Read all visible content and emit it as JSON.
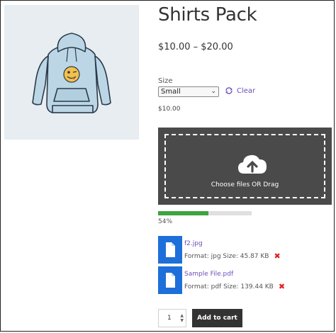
{
  "product": {
    "title": "Shirts Pack",
    "price_range": "$10.00 – $20.00",
    "image_icon": "hoodie-product-image"
  },
  "variation": {
    "label": "Size",
    "selected": "Small",
    "clear_label": "Clear",
    "price": "$10.00"
  },
  "upload": {
    "drop_text": "Choose files OR Drag",
    "progress_percent": 54,
    "progress_label": "54%",
    "progress_color": "#3fa33f",
    "files": [
      {
        "name": "f2.jpg",
        "meta": "Format: jpg Size: 45.87 KB"
      },
      {
        "name": "Sample File.pdf",
        "meta": "Format: pdf Size: 139.44 KB"
      }
    ]
  },
  "cart": {
    "quantity": "1",
    "add_label": "Add to cart"
  },
  "colors": {
    "accent_link": "#6b4fb8",
    "file_icon": "#1e6fd9",
    "dropzone_bg": "#4a4a4a",
    "remove": "#e02020"
  }
}
